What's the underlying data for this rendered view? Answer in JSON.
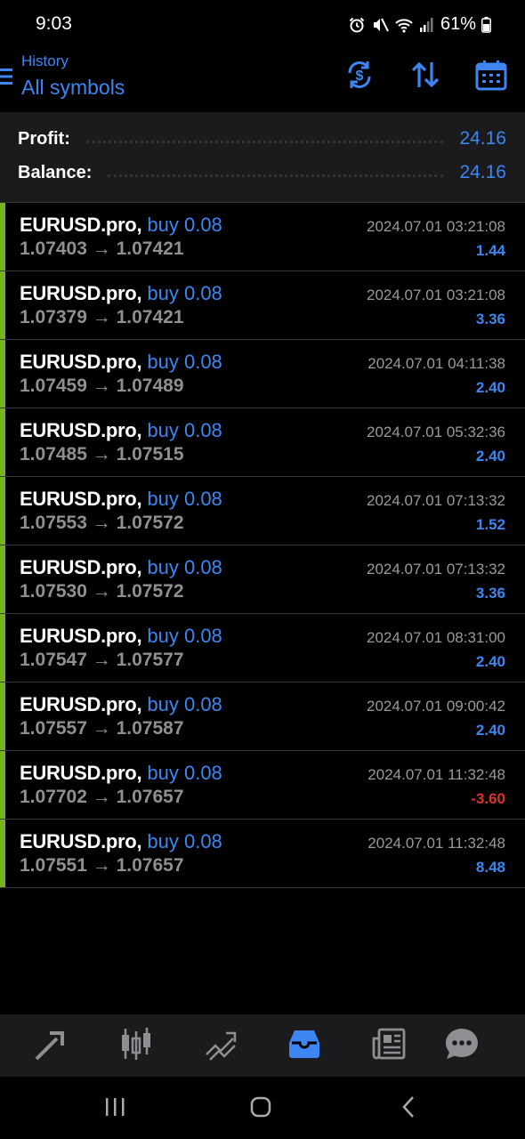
{
  "status_bar": {
    "time": "9:03",
    "battery": "61%"
  },
  "header": {
    "subtitle": "History",
    "title": "All symbols"
  },
  "summary": {
    "profit_label": "Profit:",
    "profit_value": "24.16",
    "balance_label": "Balance:",
    "balance_value": "24.16"
  },
  "trades": [
    {
      "symbol": "EURUSD.pro,",
      "side": "buy 0.08",
      "open_price": "1.07403",
      "close_price": "1.07421",
      "time": "2024.07.01 03:21:08",
      "profit": "1.44"
    },
    {
      "symbol": "EURUSD.pro,",
      "side": "buy 0.08",
      "open_price": "1.07379",
      "close_price": "1.07421",
      "time": "2024.07.01 03:21:08",
      "profit": "3.36"
    },
    {
      "symbol": "EURUSD.pro,",
      "side": "buy 0.08",
      "open_price": "1.07459",
      "close_price": "1.07489",
      "time": "2024.07.01 04:11:38",
      "profit": "2.40"
    },
    {
      "symbol": "EURUSD.pro,",
      "side": "buy 0.08",
      "open_price": "1.07485",
      "close_price": "1.07515",
      "time": "2024.07.01 05:32:36",
      "profit": "2.40"
    },
    {
      "symbol": "EURUSD.pro,",
      "side": "buy 0.08",
      "open_price": "1.07553",
      "close_price": "1.07572",
      "time": "2024.07.01 07:13:32",
      "profit": "1.52"
    },
    {
      "symbol": "EURUSD.pro,",
      "side": "buy 0.08",
      "open_price": "1.07530",
      "close_price": "1.07572",
      "time": "2024.07.01 07:13:32",
      "profit": "3.36"
    },
    {
      "symbol": "EURUSD.pro,",
      "side": "buy 0.08",
      "open_price": "1.07547",
      "close_price": "1.07577",
      "time": "2024.07.01 08:31:00",
      "profit": "2.40"
    },
    {
      "symbol": "EURUSD.pro,",
      "side": "buy 0.08",
      "open_price": "1.07557",
      "close_price": "1.07587",
      "time": "2024.07.01 09:00:42",
      "profit": "2.40"
    },
    {
      "symbol": "EURUSD.pro,",
      "side": "buy 0.08",
      "open_price": "1.07702",
      "close_price": "1.07657",
      "time": "2024.07.01 11:32:48",
      "profit": "-3.60"
    },
    {
      "symbol": "EURUSD.pro,",
      "side": "buy 0.08",
      "open_price": "1.07551",
      "close_price": "1.07657",
      "time": "2024.07.01 11:32:48",
      "profit": "8.48"
    }
  ],
  "arrow_glyph": "→",
  "bottom_nav": {
    "items": [
      "quotes-icon",
      "chart-icon",
      "trade-icon",
      "history-icon",
      "news-icon",
      "chat-icon"
    ],
    "active": "history-icon"
  },
  "colors": {
    "accent": "#3d86f2",
    "loss": "#e0312c",
    "buy_bar": "#75b41f",
    "inactive_icon": "#8e8e93"
  }
}
